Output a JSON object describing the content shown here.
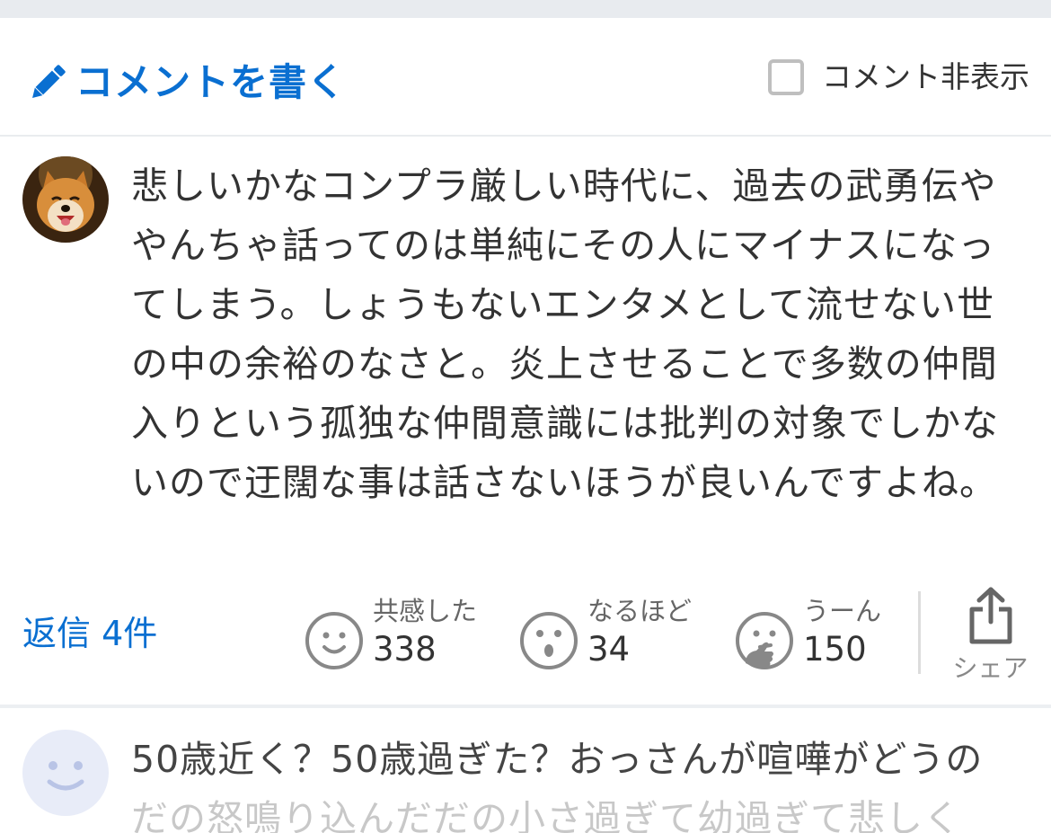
{
  "header": {
    "write_label": "コメントを書く",
    "hide_label": "コメント非表示",
    "hide_checked": false,
    "accent": "#0a6fd1"
  },
  "comment": {
    "text": "悲しいかなコンプラ厳しい時代に、過去の武勇伝ややんちゃ話ってのは単純にその人にマイナスになってしまう。しょうもないエンタメとして流せない世の中の余裕のなさと。炎上させることで多数の仲間入りという孤独な仲間意識には批判の対象でしかないので迂闊な事は話さないほうが良いんですよね。",
    "replies_label": "返信 4件",
    "reactions": [
      {
        "label": "共感した",
        "count": "338",
        "icon": "smile-face-icon"
      },
      {
        "label": "なるほど",
        "count": "34",
        "icon": "surprised-face-icon"
      },
      {
        "label": "うーん",
        "count": "150",
        "icon": "thinking-face-icon"
      }
    ],
    "share_label": "シェア"
  },
  "next_comment": {
    "line1": "50歳近く？50歳過ぎた？おっさんが喧嘩がどうの",
    "line2": "だの怒鳴り込んだだの小さ過ぎて幼過ぎて悲しく"
  }
}
